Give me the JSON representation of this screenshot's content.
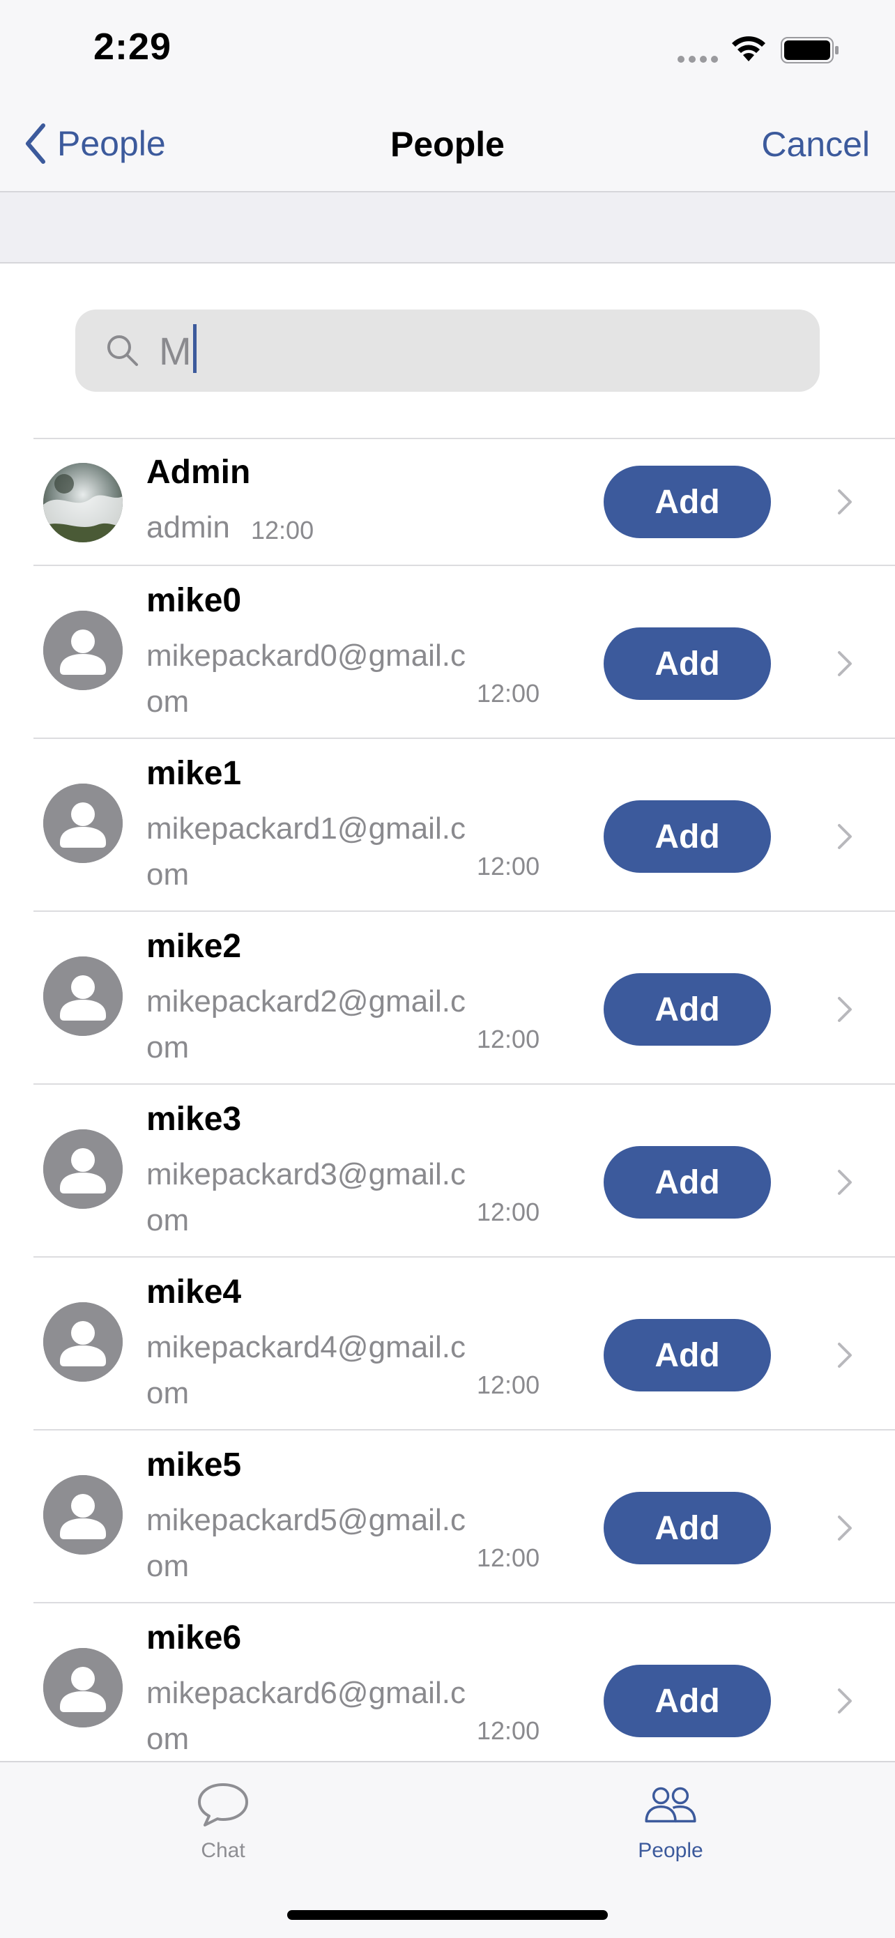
{
  "status_bar": {
    "time": "2:29"
  },
  "nav": {
    "back_label": "People",
    "title": "People",
    "cancel_label": "Cancel"
  },
  "search": {
    "value": "M"
  },
  "people": [
    {
      "name": "Admin",
      "subtitle": "admin",
      "time": "12:00",
      "add_label": "Add",
      "avatar": "photo"
    },
    {
      "name": "mike0",
      "subtitle": "mikepackard0@gmail.com",
      "time": "12:00",
      "add_label": "Add",
      "avatar": "person-placeholder"
    },
    {
      "name": "mike1",
      "subtitle": "mikepackard1@gmail.com",
      "time": "12:00",
      "add_label": "Add",
      "avatar": "person-placeholder"
    },
    {
      "name": "mike2",
      "subtitle": "mikepackard2@gmail.com",
      "time": "12:00",
      "add_label": "Add",
      "avatar": "person-placeholder"
    },
    {
      "name": "mike3",
      "subtitle": "mikepackard3@gmail.com",
      "time": "12:00",
      "add_label": "Add",
      "avatar": "person-placeholder"
    },
    {
      "name": "mike4",
      "subtitle": "mikepackard4@gmail.com",
      "time": "12:00",
      "add_label": "Add",
      "avatar": "person-placeholder"
    },
    {
      "name": "mike5",
      "subtitle": "mikepackard5@gmail.com",
      "time": "12:00",
      "add_label": "Add",
      "avatar": "person-placeholder"
    },
    {
      "name": "mike6",
      "subtitle": "mikepackard6@gmail.com",
      "time": "12:00",
      "add_label": "Add",
      "avatar": "person-placeholder"
    }
  ],
  "tab_bar": {
    "tabs": [
      {
        "label": "Chat",
        "icon": "chat-bubble-icon",
        "selected": false
      },
      {
        "label": "People",
        "icon": "people-icon",
        "selected": true
      }
    ]
  },
  "colors": {
    "accent": "#3c5a9c",
    "secondary_text": "#8a8a8e",
    "avatar_placeholder": "#8e8e92"
  }
}
